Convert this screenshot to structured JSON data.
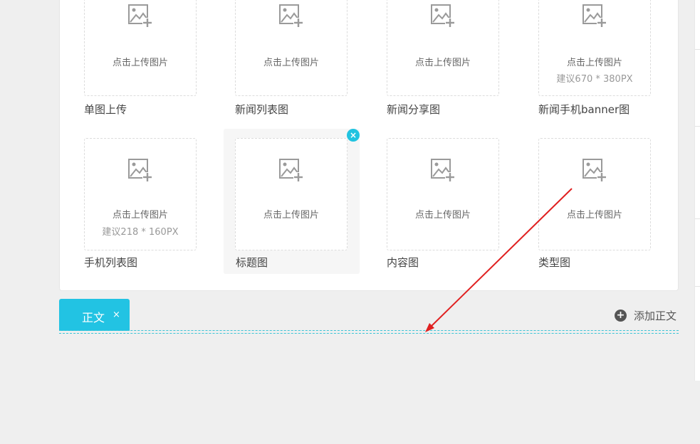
{
  "upload_hint": "点击上传图片",
  "slots": [
    {
      "label": "单图上传",
      "suggest": ""
    },
    {
      "label": "新闻列表图",
      "suggest": ""
    },
    {
      "label": "新闻分享图",
      "suggest": ""
    },
    {
      "label": "新闻手机banner图",
      "suggest": "建议670 * 380PX"
    },
    {
      "label": "手机列表图",
      "suggest": "建议218 * 160PX"
    },
    {
      "label": "标题图",
      "suggest": ""
    },
    {
      "label": "内容图",
      "suggest": ""
    },
    {
      "label": "类型图",
      "suggest": ""
    }
  ],
  "remove_badge": "×",
  "tab": {
    "label": "正文",
    "close": "×"
  },
  "add_body": {
    "icon": "plus-circle-icon",
    "label": "添加正文",
    "plus_glyph": "+"
  },
  "colors": {
    "accent": "#22c3e3",
    "annotation_arrow": "#e02020"
  }
}
